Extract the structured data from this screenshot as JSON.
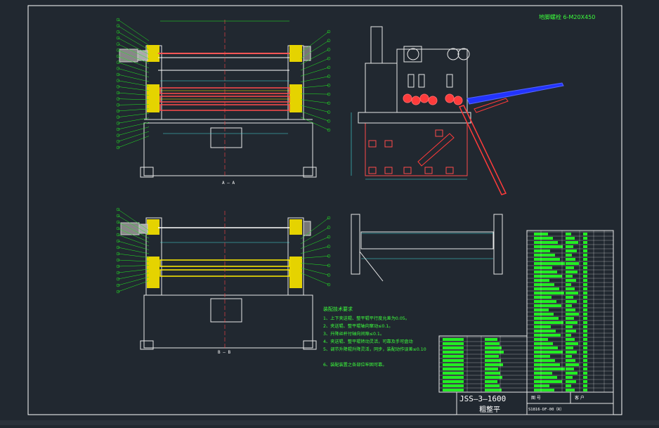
{
  "drawing": {
    "top_note": "地脚螺栓 6-M20X450",
    "section_a": "A — A",
    "section_b": "B — B",
    "notes": {
      "heading": "装配技术要求",
      "items": [
        "1、上下夹送辊、整平辊平行度允差为0.05。",
        "2、夹送辊、整平辊轴向窜动≤0.1。",
        "3、升降丝杆付轴向间隙≤0.1。",
        "4、夹送辊、整平辊转动灵活，可靠及手可盘动",
        "5、调节升降辊升降灵活，同步，装配动作误差≤0.10",
        "6、装配装置之各部位牢固可靠。"
      ]
    },
    "title_block": {
      "model": "JSS—3—1600",
      "name": "粗整平",
      "drawing_no_label": "图 号",
      "drawing_no": "S1816-DF-00（R）",
      "customer_label": "客 户"
    }
  },
  "colors": {
    "background": "#212830",
    "frame": "#ffffff",
    "part": "#e8e8e8",
    "leader": "#22ee22",
    "roller": "#ff4a4a",
    "shaft": "#ffee00",
    "dimension": "#44e0e0",
    "cylinder": "#3a4cff",
    "hydraulic": "#ff3b3b"
  }
}
